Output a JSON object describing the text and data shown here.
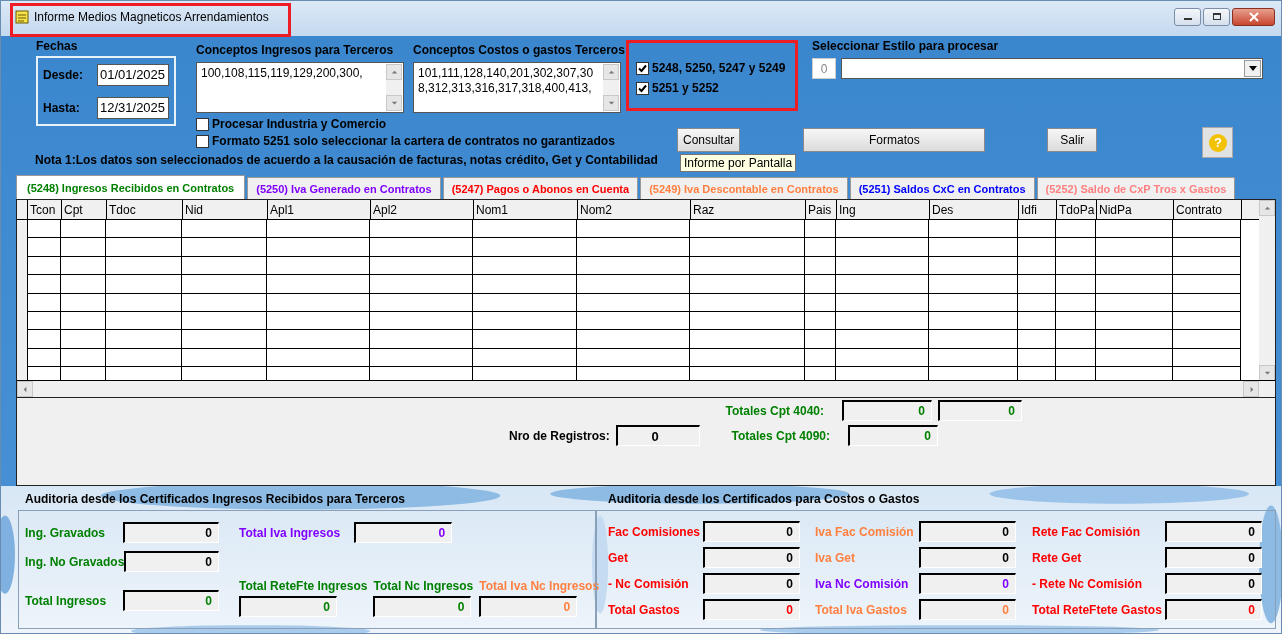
{
  "window": {
    "title": "Informe Medios Magneticos Arrendamientos"
  },
  "dates": {
    "label": "Fechas",
    "fields": [
      {
        "label": "Desde:",
        "value": "01/01/2025"
      },
      {
        "label": "Hasta:",
        "value": "12/31/2025"
      }
    ]
  },
  "concepts": [
    {
      "label": "Conceptos Ingresos para Terceros",
      "value": "100,108,115,119,129,200,300,"
    },
    {
      "label": "Conceptos Costos o gastos Terceros",
      "value": "101,111,128,140,201,302,307,308,312,313,316,317,318,400,413,"
    }
  ],
  "options": [
    {
      "label": "Procesar  Industria y Comercio",
      "checked": false
    },
    {
      "label": "Formato 5251 solo seleccionar la cartera de contratos no garantizados",
      "checked": false
    }
  ],
  "format_checks": [
    {
      "label": "5248, 5250, 5247 y 5249",
      "checked": true
    },
    {
      "label": "5251 y 5252",
      "checked": true
    }
  ],
  "style": {
    "label": "Seleccionar Estilo para procesar",
    "number": "0"
  },
  "buttons": {
    "consultar": "Consultar",
    "tooltip": "Informe por Pantalla",
    "formatos": "Formatos",
    "salir": "Salir",
    "help": "?"
  },
  "note": "Nota 1:Los datos son seleccionados de acuerdo a la causación de facturas, notas crédito, Get y Contabilidad",
  "tabs": [
    {
      "label": "(5248) Ingresos Recibidos en Contratos",
      "color": "#008000",
      "selected": true
    },
    {
      "label": "(5250) Iva Generado en Contratos",
      "color": "#8000ff",
      "selected": false
    },
    {
      "label": "(5247) Pagos o Abonos en Cuenta",
      "color": "#ff0000",
      "selected": false
    },
    {
      "label": "(5249) Iva Descontable en Contratos",
      "color": "#ff8040",
      "selected": false
    },
    {
      "label": "(5251) Saldos CxC en Contratos",
      "color": "#0000ff",
      "selected": false
    },
    {
      "label": "(5252) Saldo de CxP Tros x Gastos",
      "color": "#ff8080",
      "selected": false
    }
  ],
  "table": {
    "columns": [
      "Tcon",
      "Cpt",
      "Tdoc",
      "Nid",
      "Apl1",
      "Apl2",
      "Nom1",
      "Nom2",
      "Raz",
      "Pais",
      "Ing",
      "Des",
      "Idfi",
      "TdoPa",
      "NidPa",
      "Contrato"
    ]
  },
  "totals": {
    "cpt4040": {
      "label": "Totales Cpt 4040:",
      "values": [
        "0",
        "0"
      ]
    },
    "cpt4090": {
      "label": "Totales Cpt 4090:",
      "values": [
        "0"
      ]
    },
    "records": {
      "label": "Nro de Registros:",
      "value": "0"
    }
  },
  "audit_income": {
    "title": "Auditoria desde los Certificados Ingresos Recibidos para Terceros",
    "left": [
      {
        "label": "Ing. Gravados",
        "color": "#008000",
        "value": {
          "text": "0",
          "color": "#000000"
        }
      },
      {
        "label": "Ing. No Gravados",
        "color": "#008000",
        "value": {
          "text": "0",
          "color": "#000000"
        }
      },
      {
        "label": "Total Ingresos",
        "color": "#008000",
        "value": {
          "text": "0",
          "color": "#008000"
        }
      }
    ],
    "iva": {
      "label": "Total Iva Ingresos",
      "color": "#8000ff",
      "value": {
        "text": "0",
        "color": "#8000ff"
      }
    },
    "bottom": [
      {
        "label": "Total ReteFte Ingresos",
        "color": "#008000",
        "value": {
          "text": "0",
          "color": "#008000"
        }
      },
      {
        "label": "Total Nc Ingresos",
        "color": "#008000",
        "value": {
          "text": "0",
          "color": "#008000"
        }
      },
      {
        "label": "Total Iva Nc Ingresos",
        "color": "#ff8040",
        "value": {
          "text": "0",
          "color": "#ff8040"
        }
      }
    ]
  },
  "audit_costs": {
    "title": "Auditoria desde los Certificados para Costos o Gastos",
    "fields": [
      {
        "label": "Fac Comisiones",
        "color": "#ff0000",
        "value": {
          "text": "0",
          "color": "#000000"
        }
      },
      {
        "label": "Iva Fac Comisión",
        "color": "#ff8040",
        "value": {
          "text": "0",
          "color": "#000000"
        }
      },
      {
        "label": "Rete Fac Comisión",
        "color": "#ff0000",
        "value": {
          "text": "0",
          "color": "#000000"
        }
      },
      {
        "label": "Get",
        "color": "#ff0000",
        "value": {
          "text": "0",
          "color": "#000000"
        }
      },
      {
        "label": "Iva Get",
        "color": "#ff8040",
        "value": {
          "text": "0",
          "color": "#000000"
        }
      },
      {
        "label": "Rete Get",
        "color": "#ff0000",
        "value": {
          "text": "0",
          "color": "#000000"
        }
      },
      {
        "label": "- Nc Comisión",
        "color": "#ff0000",
        "value": {
          "text": "0",
          "color": "#000000"
        }
      },
      {
        "label": "Iva Nc Comisión",
        "color": "#8000ff",
        "value": {
          "text": "0",
          "color": "#8000ff"
        }
      },
      {
        "label": "- Rete Nc Comisión",
        "color": "#ff0000",
        "value": {
          "text": "0",
          "color": "#000000"
        }
      },
      {
        "label": "Total Gastos",
        "color": "#ff0000",
        "value": {
          "text": "0",
          "color": "#ff0000"
        }
      },
      {
        "label": "Total Iva Gastos",
        "color": "#ff8040",
        "value": {
          "text": "0",
          "color": "#ff8040"
        }
      },
      {
        "label": "Total ReteFtete Gastos",
        "color": "#ff0000",
        "value": {
          "text": "0",
          "color": "#ff0000"
        }
      }
    ]
  }
}
